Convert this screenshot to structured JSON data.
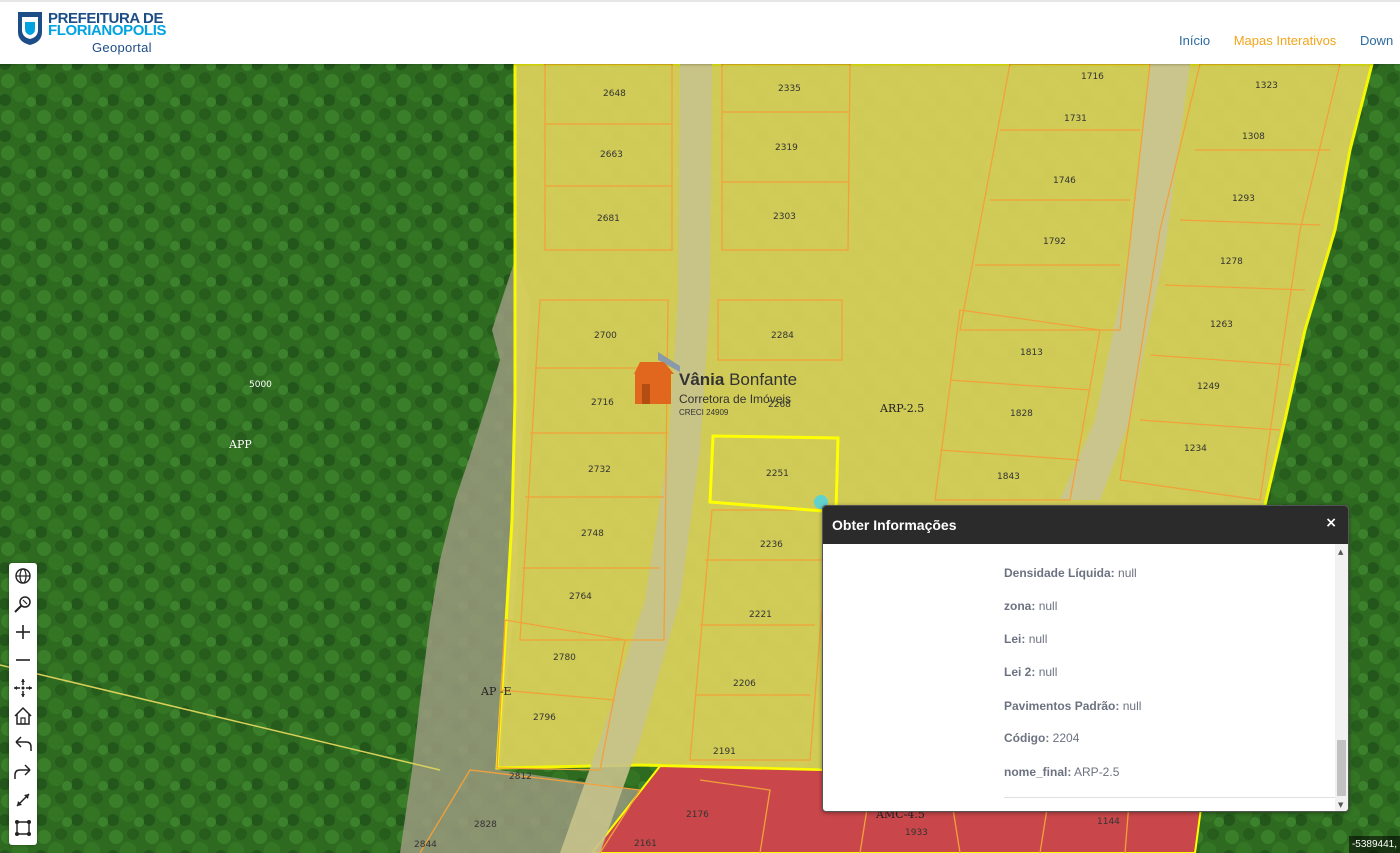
{
  "header": {
    "logo": {
      "line1": "PREFEITURA DE",
      "line2": "FLORIANOPOLIS",
      "line3": "Geoportal"
    },
    "nav": [
      {
        "label": "Início",
        "active": false
      },
      {
        "label": "Mapas Interativos",
        "active": true
      },
      {
        "label": "Down",
        "active": false
      }
    ]
  },
  "map": {
    "zones": [
      "APP",
      "ARP-2.5",
      "AP -E",
      "AMC-4.5"
    ],
    "parcels": [
      "2648",
      "2335",
      "1716",
      "1323",
      "2663",
      "2319",
      "1731",
      "1308",
      "2681",
      "2303",
      "1746",
      "1293",
      "1792",
      "1278",
      "2700",
      "2284",
      "1263",
      "1813",
      "2716",
      "2268",
      "1249",
      "1828",
      "2732",
      "2251",
      "1234",
      "1843",
      "2748",
      "2236",
      "2764",
      "2221",
      "2780",
      "2206",
      "2796",
      "2191",
      "2812",
      "2176",
      "2828",
      "2161",
      "2844",
      "1933",
      "1144",
      "5000"
    ]
  },
  "watermark": {
    "name_bold": "Vânia",
    "name_rest": " Bonfante",
    "subtitle": "Corretora de Imóveis",
    "creci": "CRECI 24909"
  },
  "panel": {
    "title": "Obter Informações",
    "close": "×",
    "rows": [
      {
        "key": "Densidade Líquida:",
        "value": "null"
      },
      {
        "key": "zona:",
        "value": "null"
      },
      {
        "key": "Lei:",
        "value": "null"
      },
      {
        "key": "Lei 2:",
        "value": "null"
      },
      {
        "key": "Pavimentos Padrão:",
        "value": "null"
      },
      {
        "key": "Código:",
        "value": "2204"
      },
      {
        "key": "nome_final:",
        "value": "ARP-2.5"
      }
    ]
  },
  "toolbar": [
    "globe-icon",
    "zoom-search-icon",
    "zoom-in-icon",
    "zoom-out-icon",
    "full-extent-icon",
    "home-icon",
    "undo-icon",
    "redo-icon",
    "measure-icon",
    "select-area-icon"
  ],
  "coords": "-5389441,",
  "colors": {
    "forest": "#2f6e22",
    "zone_yellow": "#e8df48",
    "zone_red": "#d23a3a",
    "parcel_line": "#f2a13a",
    "zone_line": "#ffff00",
    "nav_active": "#f2a51b",
    "nav": "#2c6aa0"
  }
}
